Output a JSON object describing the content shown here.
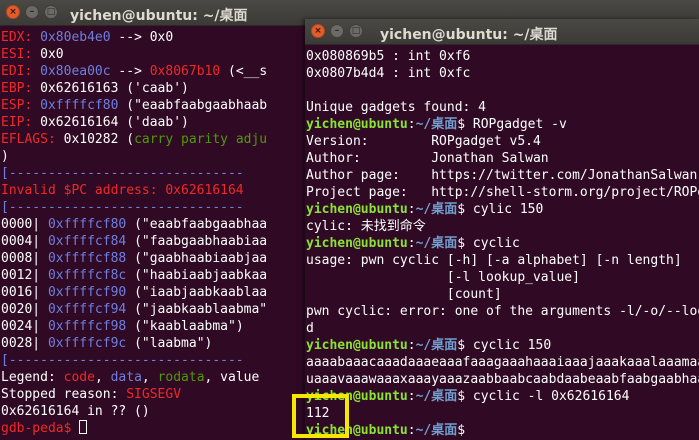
{
  "left_window": {
    "title": "yichen@ubuntu: ~/桌面",
    "lines": [
      [
        {
          "t": "EDX: ",
          "c": "r"
        },
        {
          "t": "0x80eb4e0",
          "c": "b"
        },
        {
          "t": " --> 0x0"
        }
      ],
      [
        {
          "t": "ESI: ",
          "c": "r"
        },
        {
          "t": "0x0"
        }
      ],
      [
        {
          "t": "EDI: ",
          "c": "r"
        },
        {
          "t": "0x80ea00c",
          "c": "b"
        },
        {
          "t": " --> "
        },
        {
          "t": "0x8067b10",
          "c": "r"
        },
        {
          "t": " (<__s"
        }
      ],
      [
        {
          "t": "EBP: ",
          "c": "r"
        },
        {
          "t": "0x62616163 ('caab')"
        }
      ],
      [
        {
          "t": "ESP: ",
          "c": "r"
        },
        {
          "t": "0xffffcf80",
          "c": "b"
        },
        {
          "t": " (\"eaabfaabgaabhaab"
        }
      ],
      [
        {
          "t": "EIP: ",
          "c": "r"
        },
        {
          "t": "0x62616164 ('daab')"
        }
      ],
      [
        {
          "t": "EFLAGS: ",
          "c": "r"
        },
        {
          "t": "0x10282 ("
        },
        {
          "t": "carry parity adju",
          "c": "g"
        }
      ],
      [
        {
          "t": ")"
        }
      ],
      [
        {
          "t": "[------------------------------",
          "c": "b"
        }
      ],
      [
        {
          "t": "Invalid $PC address: 0x62616164",
          "c": "r"
        }
      ],
      [
        {
          "t": "[------------------------------",
          "c": "b"
        }
      ],
      [
        {
          "t": "0000| "
        },
        {
          "t": "0xffffcf80",
          "c": "b"
        },
        {
          "t": " (\"eaabfaabgaabhaa"
        }
      ],
      [
        {
          "t": "0004| "
        },
        {
          "t": "0xffffcf84",
          "c": "b"
        },
        {
          "t": " (\"faabgaabhaabiaa"
        }
      ],
      [
        {
          "t": "0008| "
        },
        {
          "t": "0xffffcf88",
          "c": "b"
        },
        {
          "t": " (\"gaabhaabiaabjaa"
        }
      ],
      [
        {
          "t": "0012| "
        },
        {
          "t": "0xffffcf8c",
          "c": "b"
        },
        {
          "t": " (\"haabiaabjaabkaa"
        }
      ],
      [
        {
          "t": "0016| "
        },
        {
          "t": "0xffffcf90",
          "c": "b"
        },
        {
          "t": " (\"iaabjaabkaablaa"
        }
      ],
      [
        {
          "t": "0020| "
        },
        {
          "t": "0xffffcf94",
          "c": "b"
        },
        {
          "t": " (\"jaabkaablaabma\""
        }
      ],
      [
        {
          "t": "0024| "
        },
        {
          "t": "0xffffcf98",
          "c": "b"
        },
        {
          "t": " (\"kaablaabma\")"
        }
      ],
      [
        {
          "t": "0028| "
        },
        {
          "t": "0xffffcf9c",
          "c": "b"
        },
        {
          "t": " (\"laabma\")"
        }
      ],
      [
        {
          "t": "[------------------------------",
          "c": "b"
        }
      ],
      [
        {
          "t": "Legend: "
        },
        {
          "t": "code",
          "c": "r"
        },
        {
          "t": ", "
        },
        {
          "t": "data",
          "c": "b"
        },
        {
          "t": ", "
        },
        {
          "t": "rodata",
          "c": "g"
        },
        {
          "t": ", value"
        }
      ],
      [
        {
          "t": "Stopped reason: "
        },
        {
          "t": "SIGSEGV",
          "c": "r"
        }
      ],
      [
        {
          "t": "0x62616164 in ?? ()"
        }
      ],
      [
        {
          "t": "gdb-peda$ ",
          "c": "r"
        }
      ]
    ]
  },
  "right_window": {
    "title": "yichen@ubuntu: ~/桌面",
    "lines": [
      [
        {
          "t": "0x080869b5 : int 0xf6"
        }
      ],
      [
        {
          "t": "0x0807b4d4 : int 0xfc"
        }
      ],
      [
        {
          "t": ""
        }
      ],
      [
        {
          "t": "Unique gadgets found: 4"
        }
      ],
      [
        {
          "t": "yichen@ubuntu",
          "c": "gb"
        },
        {
          "t": ":",
          "c": "bk"
        },
        {
          "t": "~/桌面",
          "c": "pb"
        },
        {
          "t": "$ ROPgadget -v"
        }
      ],
      [
        {
          "t": "Version:        ROPgadget v5.4"
        }
      ],
      [
        {
          "t": "Author:         Jonathan Salwan"
        }
      ],
      [
        {
          "t": "Author page:    https://twitter.com/JonathanSalwan"
        }
      ],
      [
        {
          "t": "Project page:   http://shell-storm.org/project/ROPgadget/"
        }
      ],
      [
        {
          "t": "yichen@ubuntu",
          "c": "gb"
        },
        {
          "t": ":",
          "c": "bk"
        },
        {
          "t": "~/桌面",
          "c": "pb"
        },
        {
          "t": "$ cylic 150"
        }
      ],
      [
        {
          "t": "cylic: 未找到命令"
        }
      ],
      [
        {
          "t": "yichen@ubuntu",
          "c": "gb"
        },
        {
          "t": ":",
          "c": "bk"
        },
        {
          "t": "~/桌面",
          "c": "pb"
        },
        {
          "t": "$ cyclic"
        }
      ],
      [
        {
          "t": "usage: pwn cyclic [-h] [-a alphabet] [-n length]"
        }
      ],
      [
        {
          "t": "                  [-l lookup_value]"
        }
      ],
      [
        {
          "t": "                  [count]"
        }
      ],
      [
        {
          "t": "pwn cyclic: error: one of the arguments -l/-o/--lookup/count is require"
        }
      ],
      [
        {
          "t": "d"
        }
      ],
      [
        {
          "t": "yichen@ubuntu",
          "c": "gb"
        },
        {
          "t": ":",
          "c": "bk"
        },
        {
          "t": "~/桌面",
          "c": "pb"
        },
        {
          "t": "$ cyclic 150"
        }
      ],
      [
        {
          "t": "aaaabaaacaaadaaaeaaafaaagaaahaaaiaaajaaakaaalaaamaaanaaaoaaapaaaqaaaraaasaaataa"
        }
      ],
      [
        {
          "t": "uaaavaaawaaaxaaayaaazaabbaabcaabdaabeaabfaabgaabhaabiaabjaabkaablaabma"
        }
      ],
      [
        {
          "t": "yichen@ubuntu",
          "c": "gb"
        },
        {
          "t": ":",
          "c": "bk"
        },
        {
          "t": "~/桌面",
          "c": "pb"
        },
        {
          "t": "$ cyclic -l 0x62616164"
        }
      ],
      [
        {
          "t": "112"
        }
      ],
      [
        {
          "t": "yichen@ubuntu",
          "c": "gb"
        },
        {
          "t": ":",
          "c": "bk"
        },
        {
          "t": "~/桌面",
          "c": "pb"
        },
        {
          "t": "$ "
        }
      ]
    ]
  },
  "icons": {
    "close": "×",
    "minimize": "–",
    "maximize": "□"
  },
  "colors": {
    "terminal_bg": "#300a24",
    "highlight": "#f7e600",
    "close_button": "#e05d2d"
  }
}
